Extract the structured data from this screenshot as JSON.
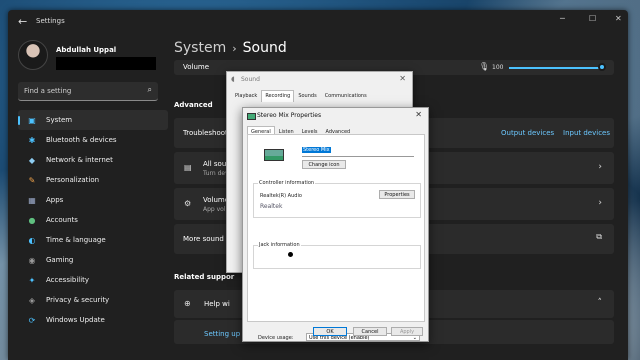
{
  "settings": {
    "app_title": "Settings",
    "back_icon": "arrow-left-icon",
    "window_controls": [
      "─",
      "☐",
      "✕"
    ],
    "user": {
      "name": "Abdullah Uppal"
    },
    "search_placeholder": "Find a setting",
    "search_icon": "search-icon",
    "nav": [
      {
        "label": "System",
        "icon": "▣",
        "color": "#4cc2ff",
        "active": true
      },
      {
        "label": "Bluetooth & devices",
        "icon": "✱",
        "color": "#4cc2ff"
      },
      {
        "label": "Network & internet",
        "icon": "◆",
        "color": "#8ecdf2"
      },
      {
        "label": "Personalization",
        "icon": "✎",
        "color": "#f0a34a"
      },
      {
        "label": "Apps",
        "icon": "▦",
        "color": "#9aa9c9"
      },
      {
        "label": "Accounts",
        "icon": "●",
        "color": "#5fbf7f"
      },
      {
        "label": "Time & language",
        "icon": "◐",
        "color": "#4cc2ff"
      },
      {
        "label": "Gaming",
        "icon": "◉",
        "color": "#9a9a9a"
      },
      {
        "label": "Accessibility",
        "icon": "✦",
        "color": "#4cc2ff"
      },
      {
        "label": "Privacy & security",
        "icon": "◈",
        "color": "#9a9a9a"
      },
      {
        "label": "Windows Update",
        "icon": "⟳",
        "color": "#4cc2ff"
      }
    ],
    "breadcrumb": {
      "parent": "System",
      "separator": "›",
      "current": "Sound"
    },
    "volume": {
      "label": "Volume",
      "value": "100",
      "level": 1.0
    },
    "advanced_heading": "Advanced",
    "troubleshoot": {
      "label": "Troubleshoot o",
      "output_link": "Output devices",
      "input_link": "Input devices"
    },
    "all_sound": {
      "label": "All sou",
      "sub": "Turn dev"
    },
    "volume_mixer": {
      "label": "Volume",
      "sub": "App volu"
    },
    "more_sound": {
      "label": "More sound se"
    },
    "related_heading": "Related suppor",
    "help": {
      "label": "Help wi"
    },
    "setting_up": {
      "label": "Setting up a"
    }
  },
  "sound_dialog": {
    "title": "Sound",
    "tabs": [
      "Playback",
      "Recording",
      "Sounds",
      "Communications"
    ],
    "selected_tab": "Recording"
  },
  "props_dialog": {
    "title": "Stereo Mix Properties",
    "tabs": [
      "General",
      "Listen",
      "Levels",
      "Advanced"
    ],
    "selected_tab": "General",
    "name_value": "Stereo Mix",
    "change_icon": "Change icon",
    "controller_heading": "Controller information",
    "controller_name": "Realtek(R) Audio",
    "properties_button": "Properties",
    "vendor": "Realtek",
    "jack_heading": "Jack information",
    "usage_label": "Device usage:",
    "usage_value": "Use this device (enable)",
    "ok": "OK",
    "cancel": "Cancel",
    "apply": "Apply"
  }
}
